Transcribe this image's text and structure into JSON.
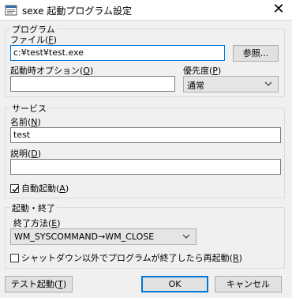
{
  "window": {
    "title": "sexe 起動プログラム設定",
    "close_glyph": "✕"
  },
  "program_group": {
    "legend": "プログラム",
    "file_label": "ファイル(",
    "file_key": "F",
    "file_label_end": ")",
    "file_value": "c:¥test¥test.exe",
    "browse_label": "参照...",
    "options_label": "起動時オプション(",
    "options_key": "O",
    "options_label_end": ")",
    "options_value": "",
    "priority_label": "優先度(",
    "priority_key": "P",
    "priority_label_end": ")",
    "priority_value": "通常"
  },
  "service_group": {
    "legend": "サービス",
    "name_label": "名前(",
    "name_key": "N",
    "name_label_end": ")",
    "name_value": "test",
    "desc_label": "説明(",
    "desc_key": "D",
    "desc_label_end": ")",
    "desc_value": "",
    "autostart_label": "自動起動(",
    "autostart_key": "A",
    "autostart_label_end": ")",
    "autostart_checked": true
  },
  "startstop_group": {
    "legend": "起動・終了",
    "exit_method_label": "終了方法(",
    "exit_method_key": "E",
    "exit_method_label_end": ")",
    "exit_method_value": "WM_SYSCOMMAND→WM_CLOSE",
    "restart_label": "シャットダウン以外でプログラムが終了したら再起動(",
    "restart_key": "R",
    "restart_label_end": ")",
    "restart_checked": false
  },
  "footer": {
    "test_label": "テスト起動(",
    "test_key": "T",
    "test_label_end": ")",
    "ok_label": "OK",
    "cancel_label": "キャンセル"
  },
  "colors": {
    "accent": "#0078d7",
    "background": "#f0f0f0"
  }
}
